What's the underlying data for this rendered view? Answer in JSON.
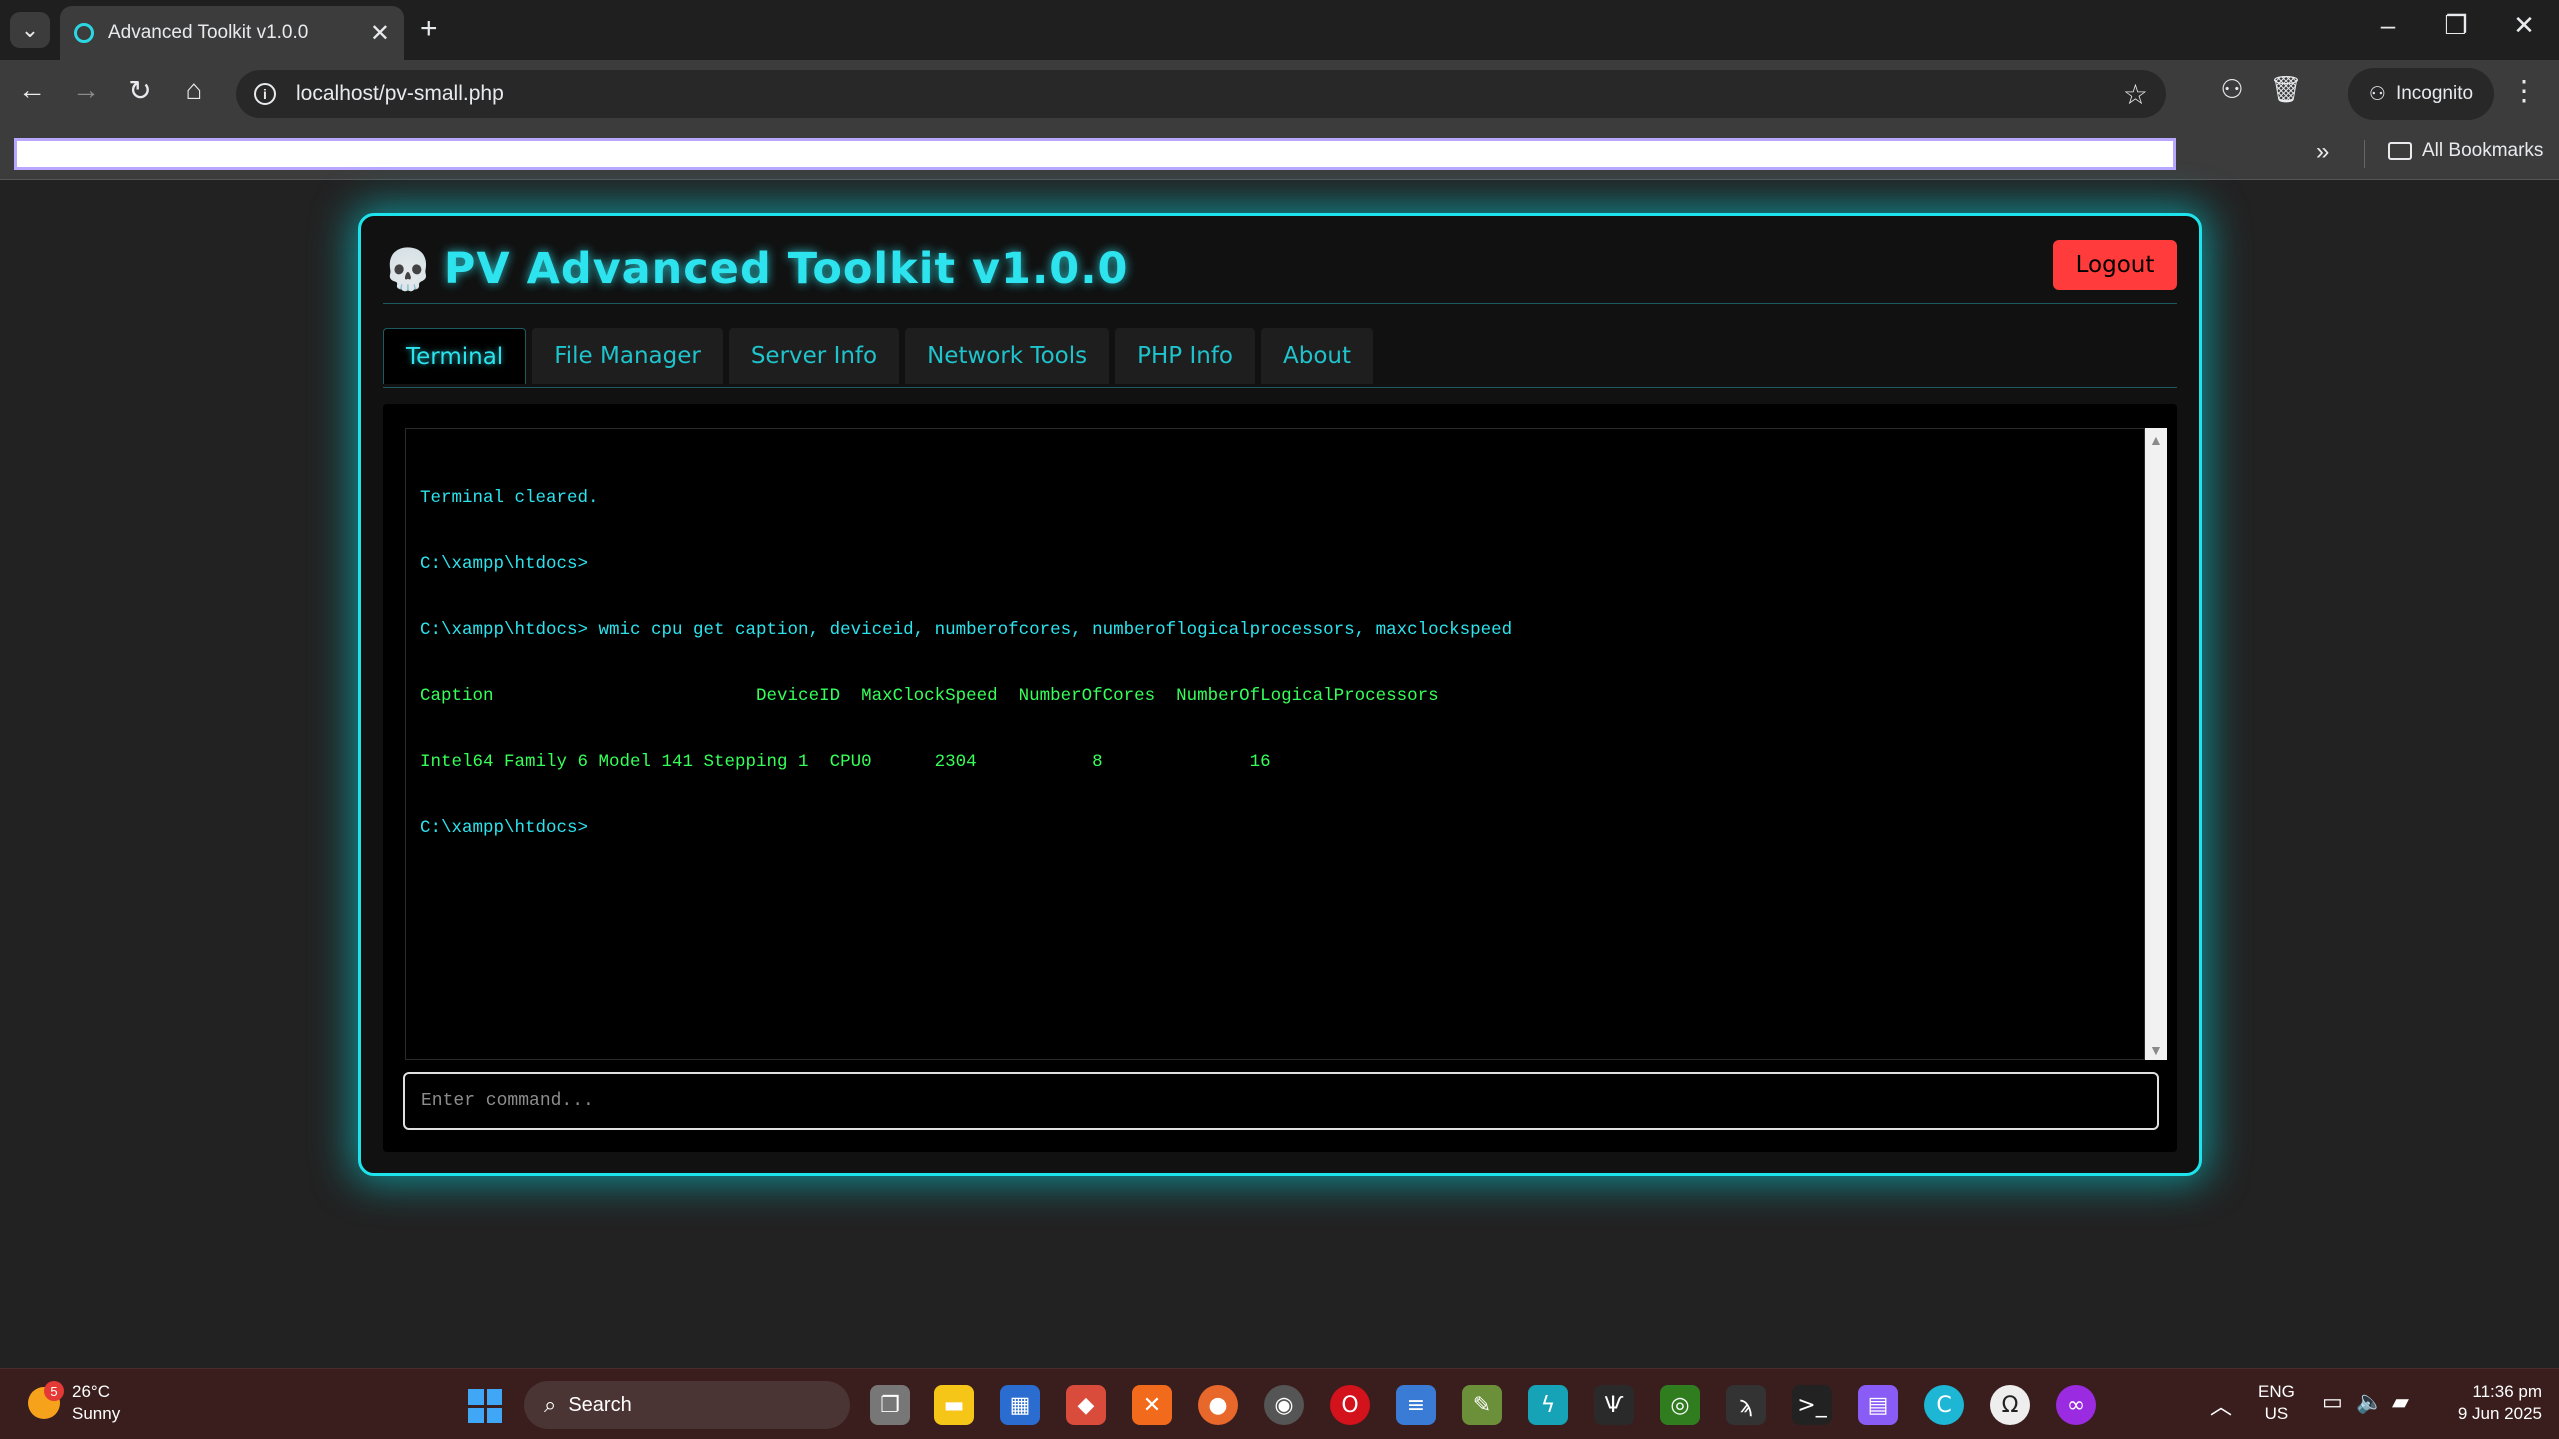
{
  "browser": {
    "tab_title": "Advanced Toolkit v1.0.0",
    "url": "localhost/pv-small.php",
    "incognito_label": "Incognito",
    "all_bookmarks_label": "All Bookmarks"
  },
  "app": {
    "title": "PV Advanced Toolkit v1.0.0",
    "logout_label": "Logout",
    "tabs": [
      {
        "label": "Terminal",
        "active": true
      },
      {
        "label": "File Manager",
        "active": false
      },
      {
        "label": "Server Info",
        "active": false
      },
      {
        "label": "Network Tools",
        "active": false
      },
      {
        "label": "PHP Info",
        "active": false
      },
      {
        "label": "About",
        "active": false
      }
    ],
    "terminal": {
      "lines": [
        {
          "type": "info",
          "text": "Terminal cleared."
        },
        {
          "type": "prompt",
          "text": "C:\\xampp\\htdocs>"
        },
        {
          "type": "prompt",
          "text": "C:\\xampp\\htdocs> wmic cpu get caption, deviceid, numberofcores, numberoflogicalprocessors, maxclockspeed"
        },
        {
          "type": "output",
          "text": "Caption                         DeviceID  MaxClockSpeed  NumberOfCores  NumberOfLogicalProcessors"
        },
        {
          "type": "output",
          "text": "Intel64 Family 6 Model 141 Stepping 1  CPU0      2304           8              16"
        },
        {
          "type": "prompt",
          "text": "C:\\xampp\\htdocs>"
        }
      ],
      "command_placeholder": "Enter command..."
    }
  },
  "taskbar": {
    "weather_temp": "26°C",
    "weather_desc": "Sunny",
    "weather_badge": "5",
    "search_label": "Search",
    "lang": "ENG",
    "region": "US",
    "time": "11:36 pm",
    "date": "9 Jun 2025"
  },
  "colors": {
    "accent": "#2de3ee",
    "logout": "#ff3b3b",
    "terminal_output": "#36ff5a"
  }
}
